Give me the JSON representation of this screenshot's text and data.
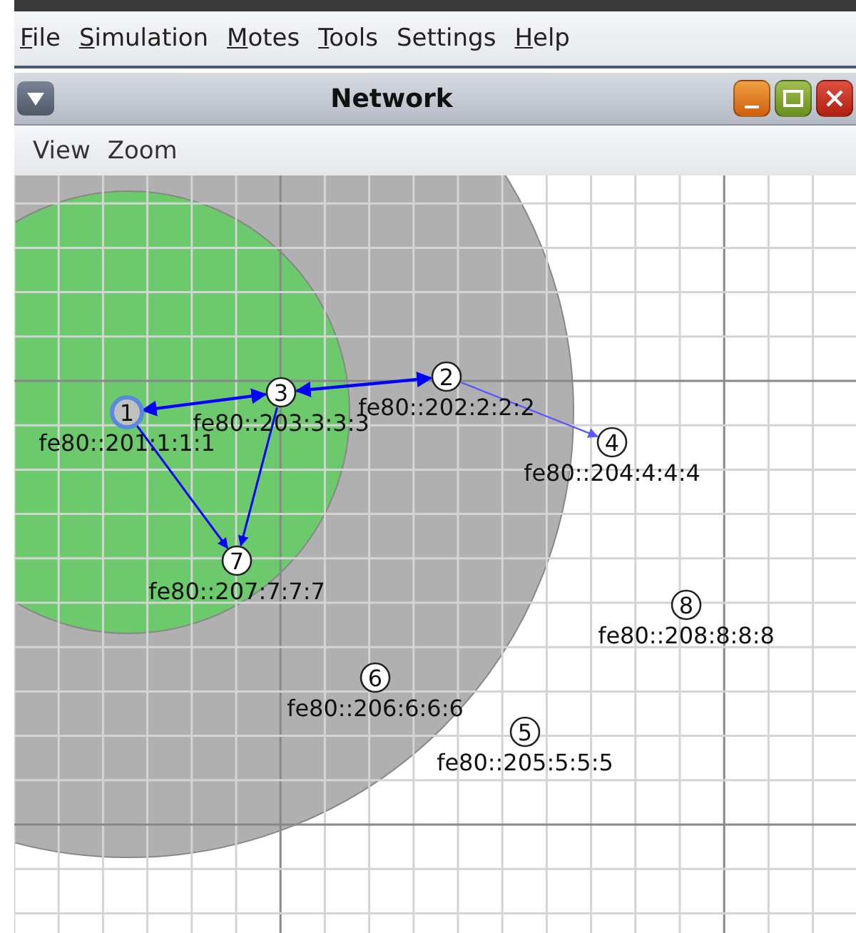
{
  "menu_bar": [
    {
      "label": "File",
      "mnemonic": true
    },
    {
      "label": "Simulation",
      "mnemonic": true
    },
    {
      "label": "Motes",
      "mnemonic": true
    },
    {
      "label": "Tools",
      "mnemonic": true
    },
    {
      "label": "Settings",
      "mnemonic": false
    },
    {
      "label": "Help",
      "mnemonic": true
    }
  ],
  "window": {
    "title": "Network",
    "menu": [
      "View",
      "Zoom"
    ]
  },
  "motes": [
    {
      "number": "1",
      "address": "fe80::201:1:1:1",
      "selected": true
    },
    {
      "number": "3",
      "address": "fe80::203:3:3:3",
      "selected": false
    },
    {
      "number": "2",
      "address": "fe80::202:2:2:2",
      "selected": false
    },
    {
      "number": "4",
      "address": "fe80::204:4:4:4",
      "selected": false
    },
    {
      "number": "7",
      "address": "fe80::207:7:7:7",
      "selected": false
    },
    {
      "number": "8",
      "address": "fe80::208:8:8:8",
      "selected": false
    },
    {
      "number": "6",
      "address": "fe80::206:6:6:6",
      "selected": false
    },
    {
      "number": "5",
      "address": "fe80::205:5:5:5",
      "selected": false
    }
  ],
  "links": [
    {
      "both_ways": true,
      "weak": false
    },
    {
      "both_ways": true,
      "weak": false
    },
    {
      "both_ways": false,
      "weak": true
    },
    {
      "both_ways": false,
      "weak": false
    },
    {
      "both_ways": false,
      "weak": false
    }
  ]
}
